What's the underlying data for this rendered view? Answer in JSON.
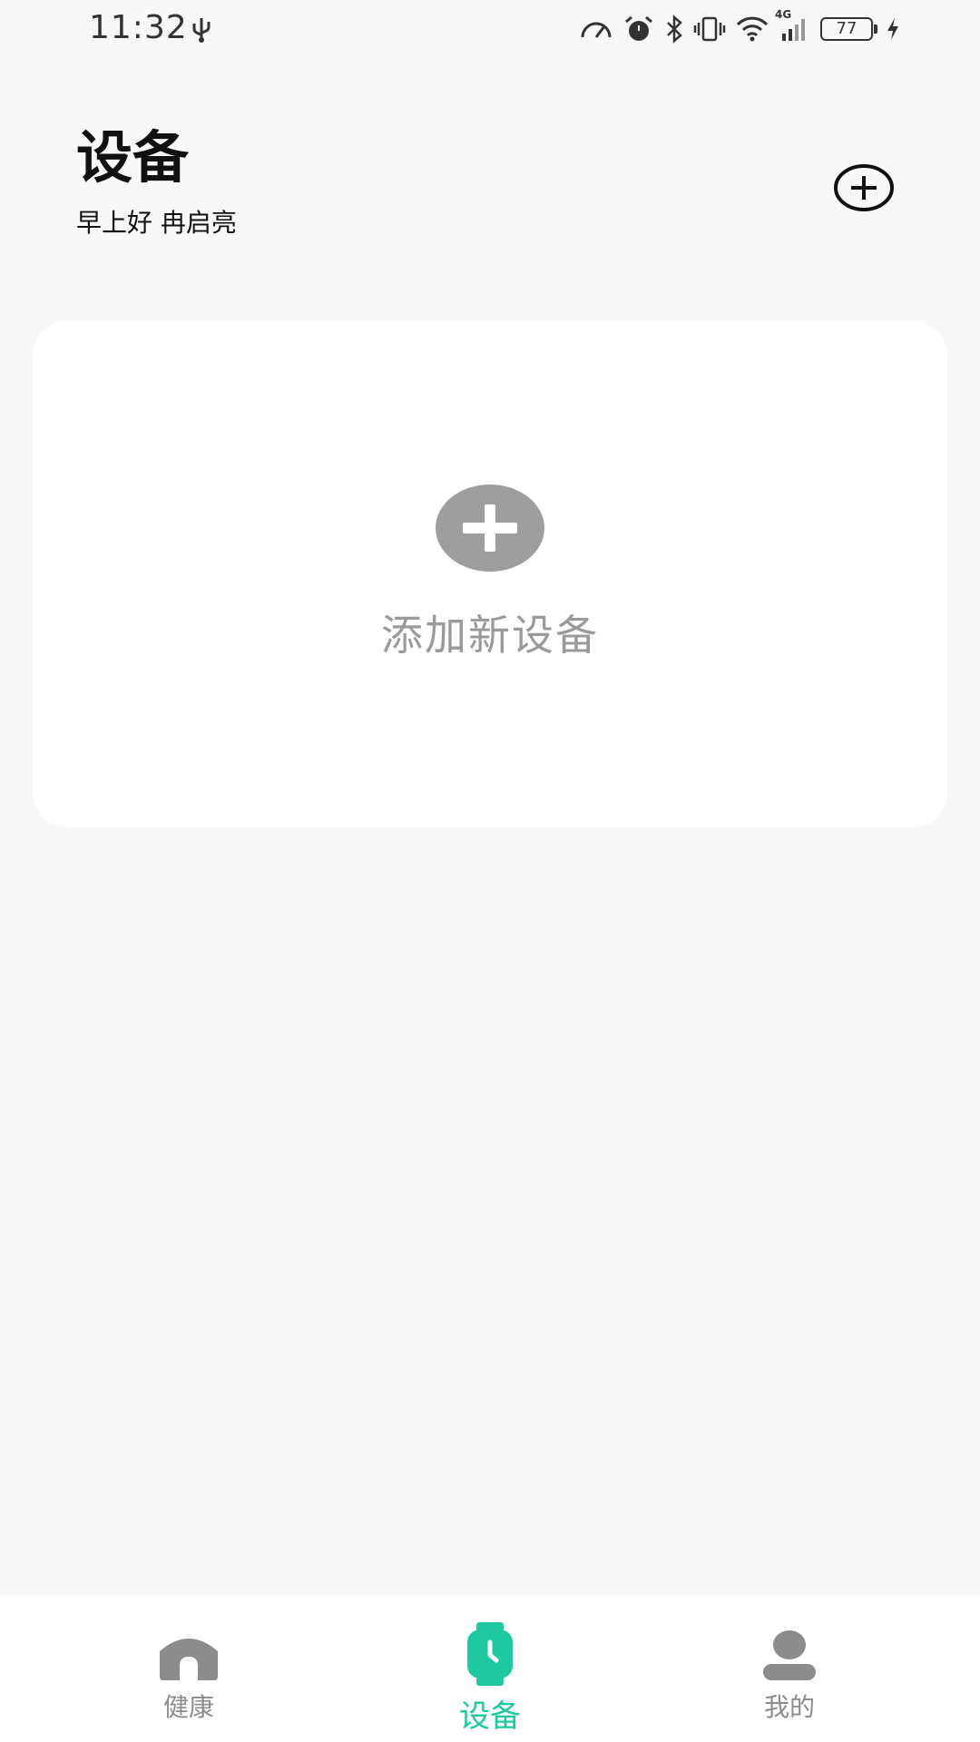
{
  "status_bar": {
    "time": "11:32",
    "battery_level": "77",
    "network_type": "4G",
    "icons": [
      "usb-icon",
      "speed-icon",
      "alarm-icon",
      "bluetooth-icon",
      "vibrate-icon",
      "wifi-icon",
      "signal-icon",
      "battery-icon",
      "charging-icon"
    ]
  },
  "header": {
    "title": "设备",
    "greeting": "早上好 冉启亮",
    "add_icon": "add-circle-icon"
  },
  "add_card": {
    "label": "添加新设备",
    "icon": "add-plus-icon"
  },
  "bottom_nav": {
    "items": [
      {
        "label": "健康",
        "icon": "home-icon",
        "active": false
      },
      {
        "label": "设备",
        "icon": "watch-icon",
        "active": true
      },
      {
        "label": "我的",
        "icon": "person-icon",
        "active": false
      }
    ],
    "active_color": "#1ec9a0",
    "inactive_color": "#8c8c8c"
  }
}
